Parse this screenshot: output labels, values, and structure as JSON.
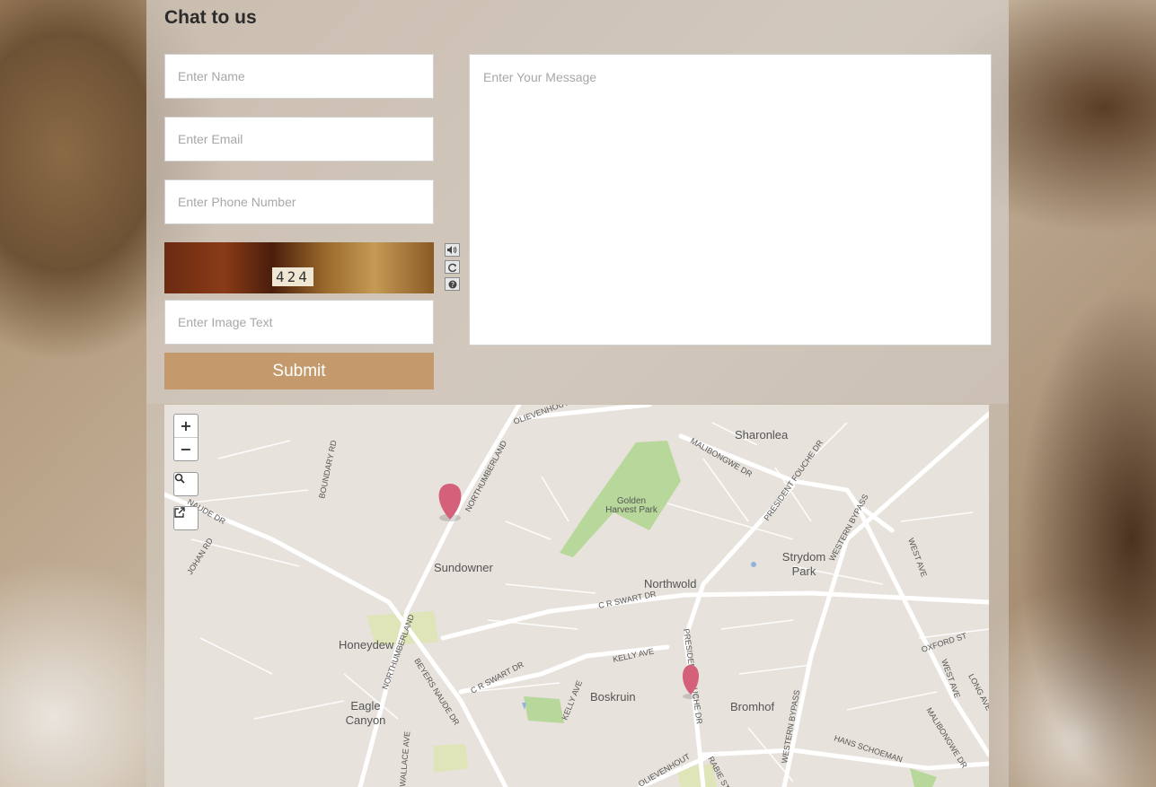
{
  "heading": "Chat to us",
  "form": {
    "name_placeholder": "Enter Name",
    "email_placeholder": "Enter Email",
    "phone_placeholder": "Enter Phone Number",
    "message_placeholder": "Enter Your Message",
    "captcha_placeholder": "Enter Image Text",
    "captcha_code": "424",
    "submit_label": "Submit",
    "captcha_icons": [
      "audio-icon",
      "refresh-icon",
      "help-icon"
    ]
  },
  "map": {
    "zoom_in": "+",
    "zoom_out": "−",
    "labels": {
      "sharonlea": "Sharonlea",
      "golden_harvest_1": "Golden",
      "golden_harvest_2": "Harvest Park",
      "strydom_1": "Strydom",
      "strydom_2": "Park",
      "sundowner": "Sundowner",
      "northwold": "Northwold",
      "honeydew": "Honeydew",
      "eagle_1": "Eagle",
      "eagle_2": "Canyon",
      "boskruin": "Boskruin",
      "bromhof": "Bromhof"
    },
    "streets": {
      "olievenhout": "OLIEVENHOUT AVE",
      "northumberland_1": "NORTHUMBERLAND",
      "northumberland_2": "NORTHUMBERLAND",
      "malibongwe_1": "MALIBONGWE DR",
      "malibongwe_2": "MALIBONGWE DR",
      "president_fouche_1": "PRESIDENT FOUCHE DR",
      "president_fouche_2": "PRESIDENT FOUCHE DR",
      "western_bypass_1": "WESTERN BYPASS",
      "western_bypass_2": "WESTERN BYPASS",
      "boundary": "BOUNDARY RD",
      "beyers_naude_1": "BEYERS NAUDE DR",
      "beyers_naude_2": "NAUDE DR",
      "johan": "JOHAN RD",
      "cr_swart_1": "C R SWART DR",
      "cr_swart_2": "C R SWART DR",
      "kelly_1": "KELLY AVE",
      "kelly_2": "KELLY AVE",
      "west_ave_1": "WEST AVE",
      "west_ave_2": "WEST AVE",
      "oxford": "OXFORD ST",
      "long": "LONG AVE",
      "hans_schoeman": "HANS SCHOEMAN",
      "rabie": "RABIE ST",
      "olievenhout_2": "OLIEVENHOUT",
      "wallace": "WALLACE AVE"
    },
    "accent_color": "#c49a6c",
    "marker_color": "#d4607a"
  }
}
